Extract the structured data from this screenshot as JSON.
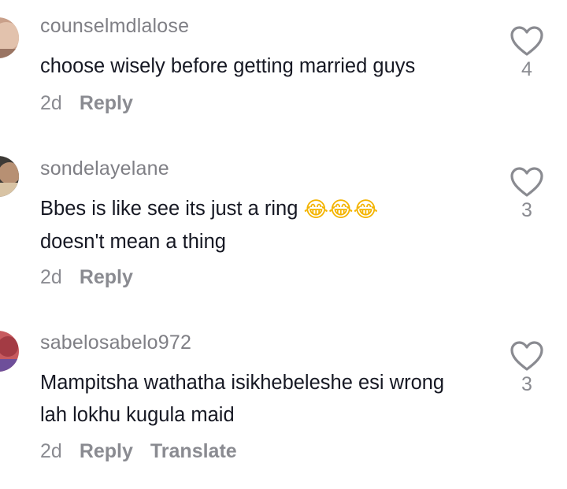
{
  "comments": [
    {
      "username": "counselmdlalose",
      "text": "choose wisely before getting married guys",
      "time": "2d",
      "reply": "Reply",
      "likes": "4"
    },
    {
      "username": "sondelayelane",
      "text": "Bbes is like see its just a ring",
      "emoji": "😂😂😂",
      "text2": "doesn't mean a thing",
      "time": "2d",
      "reply": "Reply",
      "likes": "3"
    },
    {
      "username": "sabelosabelo972",
      "text": "Mampitsha wathatha isikhebeleshe esi wrong lah lokhu kugula maid",
      "time": "2d",
      "reply": "Reply",
      "translate": "Translate",
      "likes": "3"
    }
  ]
}
